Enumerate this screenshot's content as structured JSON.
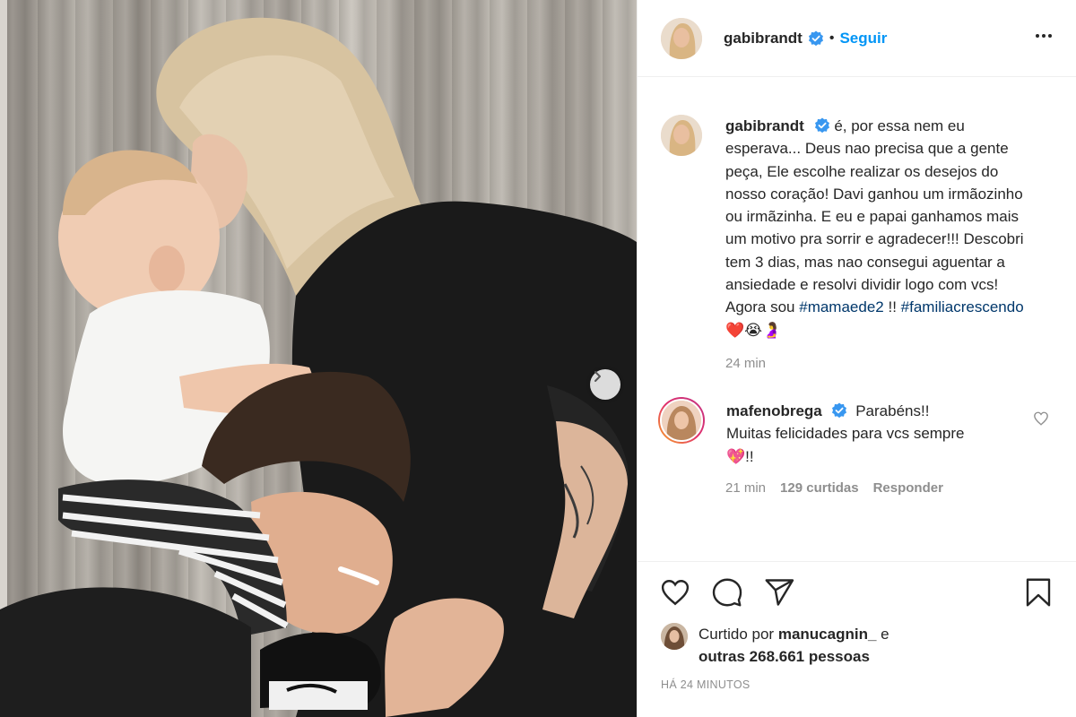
{
  "post": {
    "author": "gabibrandt",
    "dot": "•",
    "follow_label": "Seguir",
    "caption_text": "é, por essa nem eu esperava... Deus nao precisa que a gente peça, Ele escolhe realizar os desejos do nosso coração! Davi ganhou um irmãozinho ou irmãzinha. E eu e papai ganhamos mais um motivo pra sorrir e agradecer!!! Descobri tem 3 dias, mas nao consegui aguentar a ansiedade e resolvi dividir logo com vcs! Agora sou ",
    "hashtag_1": "#mamaede2",
    "caption_mid": " !! ",
    "hashtag_2": "#familiacrescendo",
    "caption_emojis": " ❤️😭🤰",
    "caption_time": "24 min"
  },
  "comment": {
    "author": "mafenobrega",
    "text": "Parabéns!! Muitas felicidades para vcs sempre💖!!",
    "time": "21 min",
    "likes": "129 curtidas",
    "reply_label": "Responder"
  },
  "likes": {
    "prefix": "Curtido por ",
    "user": "manucagnin_",
    "mid": " e ",
    "others": "outras 268.661 pessoas"
  },
  "post_age": "HÁ 24 MINUTOS",
  "colors": {
    "accent": "#0095f6",
    "hashtag": "#00376b",
    "muted": "#8e8e8e",
    "verified": "#3897f0",
    "heart_red": "#ed4956"
  },
  "icons": {
    "more": "more-options-icon",
    "carousel": "chevron-right-icon",
    "like": "heart-icon",
    "comment": "comment-icon",
    "share": "paper-plane-icon",
    "save": "bookmark-icon",
    "verified": "verified-badge-icon"
  }
}
